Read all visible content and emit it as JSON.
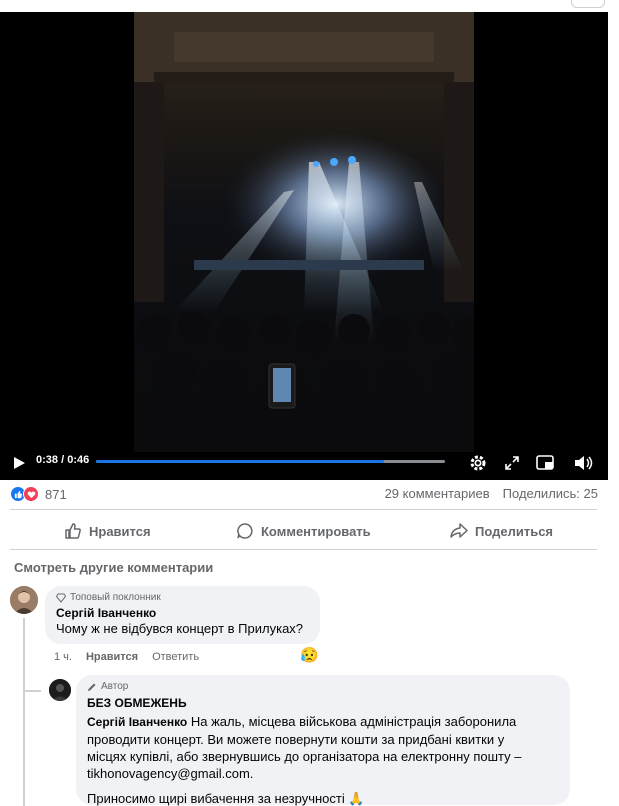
{
  "video": {
    "current_time": "0:38",
    "duration": "0:46",
    "time_separator": " / ",
    "progress_fraction": 0.826
  },
  "stats": {
    "reaction_count": "871",
    "comments": "29 комментариев",
    "shares": "Поделились: 25"
  },
  "actions": {
    "like": "Нравится",
    "comment": "Комментировать",
    "share": "Поделиться"
  },
  "see_more_comments": "Смотреть другие комментарии",
  "comments": [
    {
      "badge": "Топовый поклонник",
      "author": "Сергій Іванченко",
      "text": "Чому ж не відбувся концерт в Прилуках?",
      "time": "1 ч.",
      "like_label": "Нравится",
      "reply_label": "Ответить",
      "reaction_emoji": "😥"
    }
  ],
  "reply": {
    "badge": "Автор",
    "author": "БЕЗ ОБМЕЖЕНЬ",
    "mention": "Сергій Іванченко",
    "text_line1": " На жаль, місцева військова адміністрація заборонила",
    "text_line2": "проводити концерт. Ви можете повернути кошти за придбані квитки у",
    "text_line3": "місцях купівлі, або звернувшись до організатора на електронну пошту –",
    "text_line4": "tikhonovagency@gmail.com.",
    "text_line5": "Приносимо щирі вибачення за незручності",
    "emoji": "🙏"
  },
  "colors": {
    "accent": "#1b74e4",
    "like": "#1877f2",
    "love": "#f33e58",
    "muted_text": "#65676b",
    "bubble": "#f0f2f5"
  }
}
